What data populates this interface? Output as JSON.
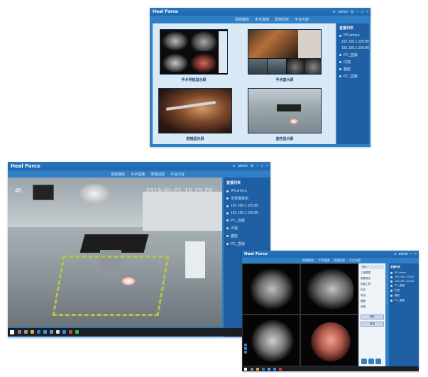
{
  "app": {
    "logo": "Heal Force",
    "user": "admin"
  },
  "nav_tabs": [
    "视频播放",
    "手术直播",
    "录像回放",
    "平台内容"
  ],
  "sidebar": {
    "title": "直播列表",
    "items": [
      {
        "label": "IPCamera",
        "count": ""
      },
      {
        "label": "192.168.1.105:80",
        "count": ""
      },
      {
        "label": "192.168.1.106:80",
        "count": ""
      },
      {
        "label": "PC_直播",
        "count": ""
      },
      {
        "label": "内镜",
        "count": ""
      },
      {
        "label": "腹腔",
        "count": ""
      },
      {
        "label": "PC_直播",
        "count": ""
      }
    ]
  },
  "sidebar_large": {
    "title": "直播列表",
    "items": [
      {
        "label": "IPCamera",
        "count": ""
      },
      {
        "label": "全景摄像机",
        "count": ""
      },
      {
        "label": "192.168.1.105:80",
        "count": ""
      },
      {
        "label": "192.168.1.106:80",
        "count": ""
      },
      {
        "label": "PC_直播",
        "count": ""
      },
      {
        "label": "内镜",
        "count": ""
      },
      {
        "label": "腹腔",
        "count": ""
      },
      {
        "label": "PC_直播",
        "count": ""
      }
    ]
  },
  "tiles": [
    {
      "caption": "手术导航显示屏"
    },
    {
      "caption": "手术室大屏"
    },
    {
      "caption": "腔镜显示屏"
    },
    {
      "caption": "监控显示屏"
    }
  ],
  "camera_overlay": {
    "channel": "48",
    "timestamp": "2019-01-01 10:15:28"
  },
  "ctrl_panel": {
    "title": "Nav",
    "rows": [
      "三维重建",
      "图像融合",
      "测量工具",
      "标注",
      "导出",
      "截图",
      "设置"
    ],
    "buttons": [
      "确定",
      "取消"
    ]
  },
  "colors": {
    "window_blue": "#2f7fc6",
    "titlebar_blue": "#1f68b0",
    "sidebar_blue": "#1f5fa3",
    "content_bg": "#d9e9f5",
    "caption_text": "#1d3f6b",
    "taskbar": "#1b1f24"
  }
}
